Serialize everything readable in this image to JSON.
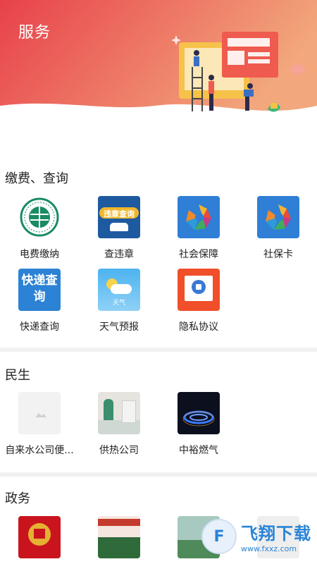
{
  "header": {
    "title": "服务"
  },
  "sections": [
    {
      "title": "缴费、查询",
      "items": [
        {
          "label": "电费缴纳"
        },
        {
          "label": "查违章",
          "icon_text": "违章查询"
        },
        {
          "label": "社会保障"
        },
        {
          "label": "社保卡"
        },
        {
          "label": "快递查询",
          "icon_text": "快递查询"
        },
        {
          "label": "天气预报",
          "icon_text": "天气"
        },
        {
          "label": "隐私协议"
        }
      ]
    },
    {
      "title": "民生",
      "items": [
        {
          "label": "自来水公司便..."
        },
        {
          "label": "供热公司"
        },
        {
          "label": "中裕燃气"
        }
      ]
    },
    {
      "title": "政务",
      "items": [
        {
          "label": ""
        },
        {
          "label": ""
        },
        {
          "label": ""
        },
        {
          "label": ""
        }
      ]
    }
  ],
  "watermark": {
    "big": "飞翔下载",
    "small": "www.fxxz.com"
  },
  "colors": {
    "header_start": "#e8414b",
    "header_end": "#f2a77c"
  }
}
